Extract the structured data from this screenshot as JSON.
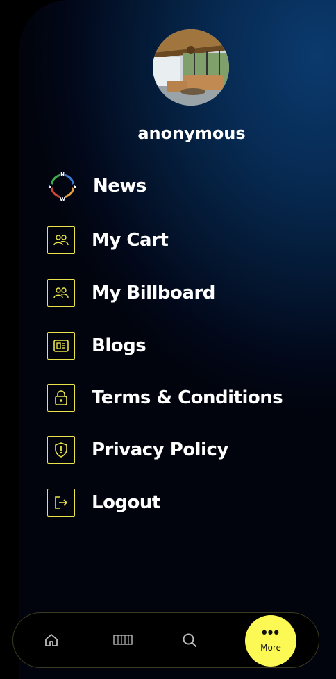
{
  "profile": {
    "username": "anonymous"
  },
  "menu": {
    "items": [
      {
        "label": "News",
        "icon": "compass-icon"
      },
      {
        "label": "My Cart",
        "icon": "users-icon"
      },
      {
        "label": "My Billboard",
        "icon": "users-icon"
      },
      {
        "label": "Blogs",
        "icon": "article-icon"
      },
      {
        "label": "Terms & Conditions",
        "icon": "lock-icon"
      },
      {
        "label": "Privacy Policy",
        "icon": "shield-icon"
      },
      {
        "label": "Logout",
        "icon": "logout-icon"
      }
    ],
    "compass_letters": {
      "n": "N",
      "s": "S",
      "e": "E",
      "w": "W"
    }
  },
  "bottom_nav": {
    "items": [
      {
        "icon": "home-icon"
      },
      {
        "icon": "billboard-icon"
      },
      {
        "icon": "search-icon"
      }
    ],
    "more_label": "More"
  },
  "colors": {
    "accent": "#fcf854",
    "icon_stroke": "#ebe34a",
    "drawer_bg": "#041a36"
  }
}
